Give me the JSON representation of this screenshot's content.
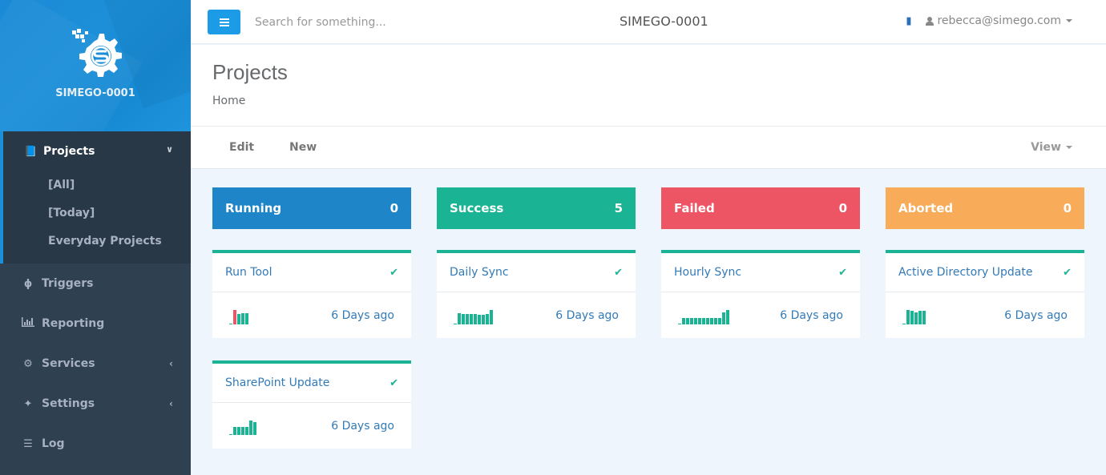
{
  "brand": {
    "name": "SIMEGO-0001",
    "logo_icon": "gear-s-logo"
  },
  "sidebar": {
    "active": {
      "label": "Projects",
      "icon": "book-icon",
      "expanded": true,
      "children": [
        {
          "label": "[All]"
        },
        {
          "label": "[Today]"
        },
        {
          "label": "Everyday Projects"
        }
      ]
    },
    "items": [
      {
        "label": "Triggers",
        "icon": "bolt-icon",
        "has_submenu": false
      },
      {
        "label": "Reporting",
        "icon": "bar-chart-icon",
        "has_submenu": false
      },
      {
        "label": "Services",
        "icon": "cogs-icon",
        "has_submenu": true
      },
      {
        "label": "Settings",
        "icon": "magic-wand-icon",
        "has_submenu": true
      },
      {
        "label": "Log",
        "icon": "list-icon",
        "has_submenu": false
      }
    ]
  },
  "topbar": {
    "search_placeholder": "Search for something...",
    "title": "SIMEGO-0001",
    "user": "rebecca@simego.com"
  },
  "header": {
    "title": "Projects",
    "breadcrumb": "Home"
  },
  "toolbar": {
    "edit": "Edit",
    "new": "New",
    "view": "View"
  },
  "stats": [
    {
      "label": "Running",
      "count": "0",
      "color": "#1e85c8"
    },
    {
      "label": "Success",
      "count": "5",
      "color": "#1ab394"
    },
    {
      "label": "Failed",
      "count": "0",
      "color": "#ed5565"
    },
    {
      "label": "Aborted",
      "count": "0",
      "color": "#f8ac59"
    }
  ],
  "projects": [
    {
      "name": "Run Tool",
      "status": "success",
      "last_run": "6 Days ago",
      "history": [
        {
          "v": 0.08,
          "s": "ok"
        },
        {
          "v": 1.0,
          "s": "fail"
        },
        {
          "v": 0.7,
          "s": "ok"
        },
        {
          "v": 0.75,
          "s": "ok"
        },
        {
          "v": 0.75,
          "s": "ok"
        }
      ]
    },
    {
      "name": "Daily Sync",
      "status": "success",
      "last_run": "6 Days ago",
      "history": [
        {
          "v": 0.05,
          "s": "ok"
        },
        {
          "v": 0.8,
          "s": "ok"
        },
        {
          "v": 0.7,
          "s": "ok"
        },
        {
          "v": 0.7,
          "s": "ok"
        },
        {
          "v": 0.7,
          "s": "ok"
        },
        {
          "v": 0.7,
          "s": "ok"
        },
        {
          "v": 0.65,
          "s": "ok"
        },
        {
          "v": 0.65,
          "s": "ok"
        },
        {
          "v": 0.7,
          "s": "ok"
        },
        {
          "v": 1.0,
          "s": "ok"
        }
      ]
    },
    {
      "name": "Hourly Sync",
      "status": "success",
      "last_run": "6 Days ago",
      "history": [
        {
          "v": 0.05,
          "s": "ok"
        },
        {
          "v": 0.45,
          "s": "ok"
        },
        {
          "v": 0.45,
          "s": "ok"
        },
        {
          "v": 0.45,
          "s": "ok"
        },
        {
          "v": 0.45,
          "s": "ok"
        },
        {
          "v": 0.45,
          "s": "ok"
        },
        {
          "v": 0.45,
          "s": "ok"
        },
        {
          "v": 0.45,
          "s": "ok"
        },
        {
          "v": 0.45,
          "s": "ok"
        },
        {
          "v": 0.45,
          "s": "ok"
        },
        {
          "v": 0.45,
          "s": "ok"
        },
        {
          "v": 0.85,
          "s": "ok"
        },
        {
          "v": 1.0,
          "s": "ok"
        }
      ]
    },
    {
      "name": "Active Directory Update",
      "status": "success",
      "last_run": "6 Days ago",
      "history": [
        {
          "v": 0.05,
          "s": "ok"
        },
        {
          "v": 1.0,
          "s": "ok"
        },
        {
          "v": 0.95,
          "s": "ok"
        },
        {
          "v": 0.85,
          "s": "ok"
        },
        {
          "v": 0.95,
          "s": "ok"
        },
        {
          "v": 0.95,
          "s": "ok"
        }
      ]
    },
    {
      "name": "SharePoint Update",
      "status": "success",
      "last_run": "6 Days ago",
      "history": [
        {
          "v": 0.08,
          "s": "ok"
        },
        {
          "v": 0.55,
          "s": "ok"
        },
        {
          "v": 0.55,
          "s": "ok"
        },
        {
          "v": 0.55,
          "s": "ok"
        },
        {
          "v": 0.55,
          "s": "ok"
        },
        {
          "v": 1.0,
          "s": "ok"
        },
        {
          "v": 0.9,
          "s": "ok"
        }
      ]
    }
  ]
}
